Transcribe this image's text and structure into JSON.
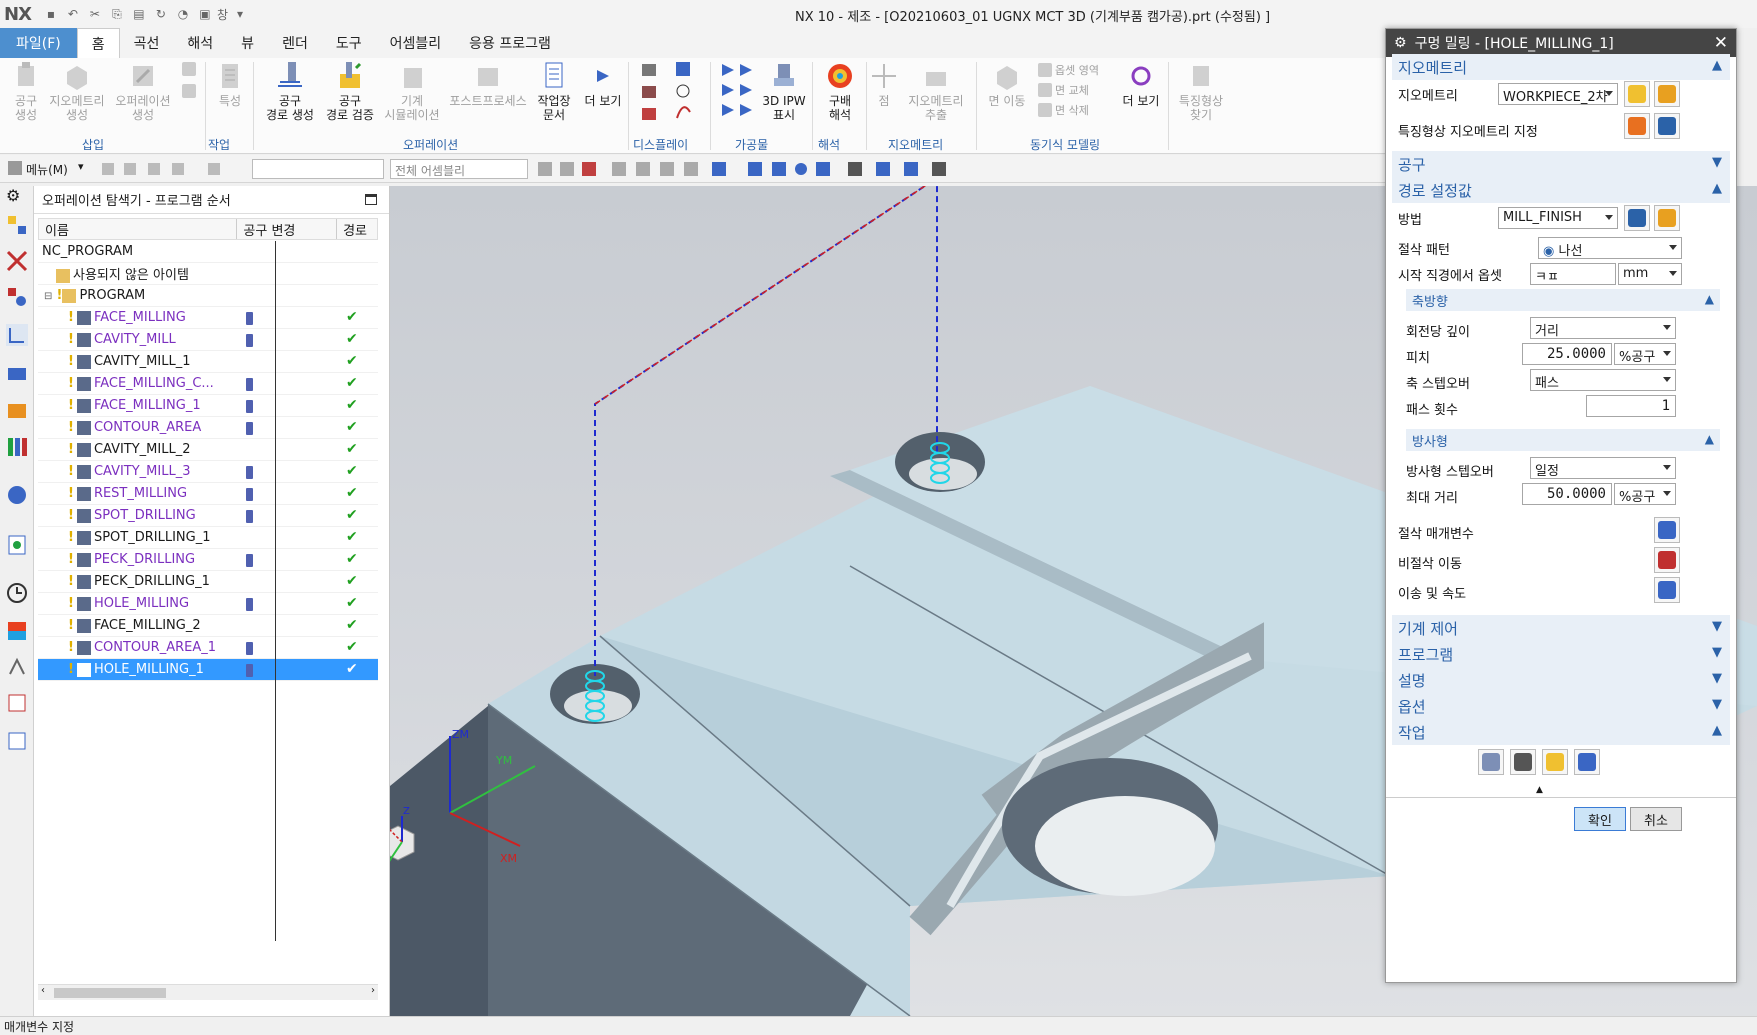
{
  "app": {
    "logo": "NX",
    "title": "NX 10 - 제조 - [O20210603_01 UGNX MCT 3D (기계부품 캠가공).prt (수정됨) ]",
    "window_menu": "창"
  },
  "menubar": {
    "file": "파일(F)",
    "tabs": [
      "홈",
      "곡선",
      "해석",
      "뷰",
      "렌더",
      "도구",
      "어셈블리",
      "응용 프로그램"
    ],
    "active_tab": "홈"
  },
  "ribbon": {
    "groups": {
      "insert": "삽입",
      "work": "작업",
      "operation": "오퍼레이션",
      "display": "디스플레이",
      "workpiece": "가공물",
      "analysis": "해석",
      "geometry": "지오메트리",
      "sync": "동기식 모델링"
    },
    "buttons": {
      "create_tool": "공구\n생성",
      "create_geometry": "지오메트리\n생성",
      "create_operation": "오퍼레이션\n생성",
      "feature": "특성",
      "gen_toolpath": "공구\n경로 생성",
      "verify_toolpath": "공구\n경로 검증",
      "machine_sim": "기계\n시뮬레이션",
      "postprocess": "포스트프로세스",
      "shop_doc": "작업장\n문서",
      "more1": "더 보기",
      "ipw": "3D IPW\n표시",
      "draft": "구배\n해석",
      "point": "점",
      "geom_extract": "지오메트리\n추출",
      "face_move": "면 이동",
      "offset_region": "옵셋 영역",
      "replace_face": "면 교체",
      "delete_face": "면 삭제",
      "more2": "더 보기",
      "feature_find": "특징형상\n찾기"
    }
  },
  "cmdbar": {
    "menu": "메뉴(M)",
    "filter_placeholder": "",
    "assembly_filter": "전체 어셈블리"
  },
  "navigator": {
    "title": "오퍼레이션 탐색기 - 프로그램 순서",
    "columns": {
      "name": "이름",
      "tool_change": "공구 변경",
      "path": "경로"
    },
    "root": "NC_PROGRAM",
    "unused": "사용되지 않은 아이템",
    "program": "PROGRAM",
    "rows": [
      {
        "name": "FACE_MILLING",
        "purple": true,
        "tool": true
      },
      {
        "name": "CAVITY_MILL",
        "purple": true,
        "tool": true
      },
      {
        "name": "CAVITY_MILL_1",
        "purple": false,
        "tool": false
      },
      {
        "name": "FACE_MILLING_C...",
        "purple": true,
        "tool": true
      },
      {
        "name": "FACE_MILLING_1",
        "purple": true,
        "tool": true
      },
      {
        "name": "CONTOUR_AREA",
        "purple": true,
        "tool": true
      },
      {
        "name": "CAVITY_MILL_2",
        "purple": false,
        "tool": false
      },
      {
        "name": "CAVITY_MILL_3",
        "purple": true,
        "tool": true
      },
      {
        "name": "REST_MILLING",
        "purple": true,
        "tool": true
      },
      {
        "name": "SPOT_DRILLING",
        "purple": true,
        "tool": true
      },
      {
        "name": "SPOT_DRILLING_1",
        "purple": false,
        "tool": false
      },
      {
        "name": "PECK_DRILLING",
        "purple": true,
        "tool": true
      },
      {
        "name": "PECK_DRILLING_1",
        "purple": false,
        "tool": false
      },
      {
        "name": "HOLE_MILLING",
        "purple": true,
        "tool": true
      },
      {
        "name": "FACE_MILLING_2",
        "purple": false,
        "tool": false
      },
      {
        "name": "CONTOUR_AREA_1",
        "purple": true,
        "tool": true
      },
      {
        "name": "HOLE_MILLING_1",
        "purple": false,
        "tool": true,
        "selected": true
      }
    ]
  },
  "viewport": {
    "axes": {
      "zm": "ZM",
      "ym": "YM",
      "xm": "XM",
      "z": "Z",
      "x": "X",
      "y": "Y"
    }
  },
  "dialog": {
    "title": "구멍 밀링 - [HOLE_MILLING_1]",
    "sections": {
      "geometry": "지오메트리",
      "tool": "공구",
      "path_settings": "경로 설정값",
      "machine_control": "기계 제어",
      "program": "프로그램",
      "description": "설명",
      "options": "옵션",
      "actions": "작업"
    },
    "geometry_label": "지오메트리",
    "geometry_value": "WORKPIECE_2차",
    "feature_geometry": "특징형상 지오메트리 지정",
    "method_label": "방법",
    "method_value": "MILL_FINISH",
    "cut_pattern_label": "절삭 패턴",
    "cut_pattern_value": "나선",
    "start_offset_label": "시작 직경에서 옵셋",
    "start_offset_value": "ㅋㅍ",
    "start_offset_unit": "mm",
    "axial": {
      "title": "축방향",
      "depth_label": "회전당 깊이",
      "depth_value": "거리",
      "pitch_label": "피치",
      "pitch_value": "25.0000",
      "pitch_unit": "%공구",
      "stepover_label": "축 스텝오버",
      "stepover_value": "패스",
      "passes_label": "패스 횟수",
      "passes_value": "1"
    },
    "radial": {
      "title": "방사형",
      "stepover_label": "방사형 스텝오버",
      "stepover_value": "일정",
      "max_label": "최대 거리",
      "max_value": "50.0000",
      "max_unit": "%공구"
    },
    "cut_params": "절삭 매개변수",
    "non_cut": "비절삭 이동",
    "feeds": "이송 및 속도",
    "ok": "확인",
    "cancel": "취소"
  },
  "status": "매개변수 지정",
  "colors": {
    "accent": "#2b62a8",
    "file_tab": "#4d8fcf",
    "selected_row": "#3399ff",
    "purple_text": "#7b2fbf",
    "check": "#20a020",
    "toolpath": "#1e2ad0",
    "helix": "#21d6e8"
  }
}
